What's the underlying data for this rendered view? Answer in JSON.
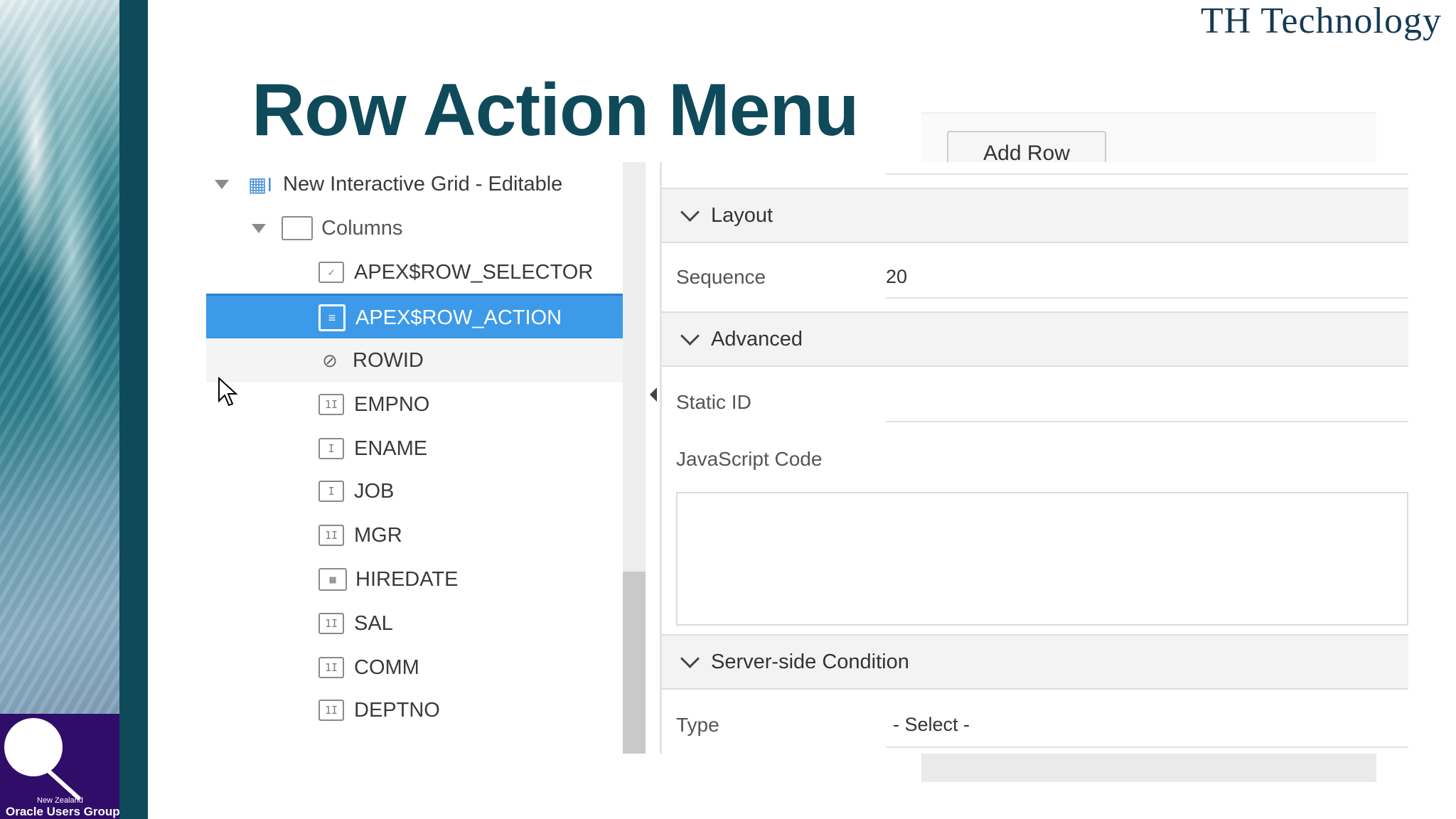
{
  "brand": {
    "name": "TH Technology"
  },
  "slide": {
    "title": "Row Action Menu"
  },
  "logo": {
    "small_text": "New Zealand",
    "text": "Oracle Users Group"
  },
  "toolbar": {
    "add_row_label": "Add Row"
  },
  "tree": {
    "root_label": "New Interactive Grid - Editable",
    "columns_folder_label": "Columns",
    "columns": [
      {
        "label": "APEX$ROW_SELECTOR",
        "icon": "checkbox-icon"
      },
      {
        "label": "APEX$ROW_ACTION",
        "icon": "clipboard-icon",
        "selected": true
      },
      {
        "label": "ROWID",
        "icon": "hidden-eye-icon"
      },
      {
        "label": "EMPNO",
        "icon": "number-field-icon"
      },
      {
        "label": "ENAME",
        "icon": "text-field-icon"
      },
      {
        "label": "JOB",
        "icon": "text-field-icon"
      },
      {
        "label": "MGR",
        "icon": "number-field-icon"
      },
      {
        "label": "HIREDATE",
        "icon": "calendar-icon"
      },
      {
        "label": "SAL",
        "icon": "number-field-icon"
      },
      {
        "label": "COMM",
        "icon": "number-field-icon"
      },
      {
        "label": "DEPTNO",
        "icon": "number-field-icon"
      }
    ]
  },
  "properties": {
    "layout": {
      "title": "Layout",
      "sequence_label": "Sequence",
      "sequence_value": "20"
    },
    "advanced": {
      "title": "Advanced",
      "static_id_label": "Static ID",
      "javascript_label": "JavaScript Code"
    },
    "condition": {
      "title": "Server-side Condition",
      "type_label": "Type",
      "type_value": "- Select -"
    }
  },
  "colors": {
    "title": "#0f4a5b",
    "selection": "#3d9ae8",
    "logo_bg": "#2f0d69"
  }
}
